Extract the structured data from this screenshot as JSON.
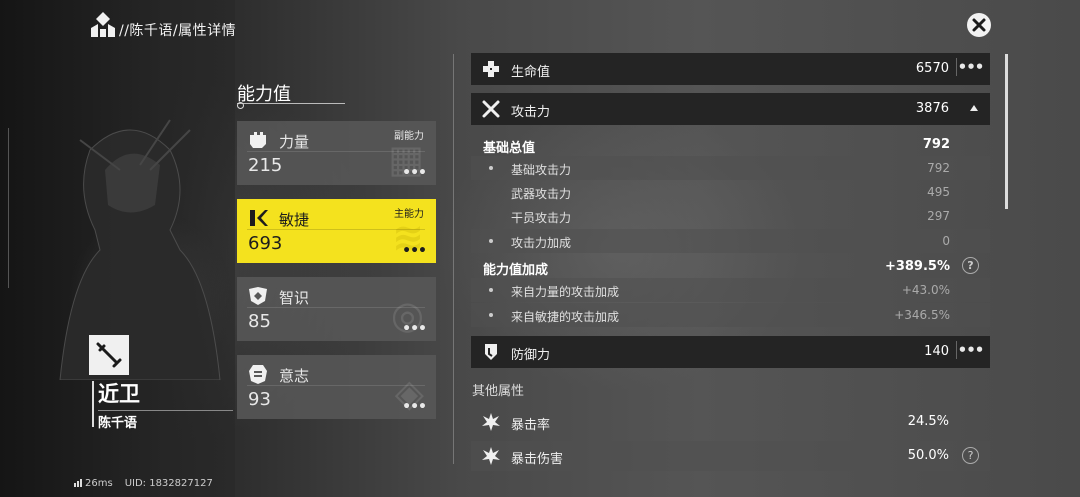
{
  "header": {
    "breadcrumb": "//陈千语/属性详情"
  },
  "character": {
    "class": "近卫",
    "name": "陈千语"
  },
  "status": {
    "ping": "26ms",
    "uid": "UID: 1832827127"
  },
  "abilities": {
    "title": "能力值",
    "cards": [
      {
        "name": "力量",
        "value": "215",
        "tag": "副能力",
        "icon": "fist-icon",
        "active": false
      },
      {
        "name": "敏捷",
        "value": "693",
        "tag": "主能力",
        "icon": "agility-icon",
        "active": true
      },
      {
        "name": "智识",
        "value": "85",
        "tag": "",
        "icon": "intellect-icon",
        "active": false
      },
      {
        "name": "意志",
        "value": "93",
        "tag": "",
        "icon": "will-icon",
        "active": false
      }
    ],
    "more": "•••"
  },
  "attributes": {
    "hp": {
      "name": "生命值",
      "value": "6570",
      "icon": "health-cross-icon"
    },
    "atk": {
      "name": "攻击力",
      "value": "3876",
      "icon": "crossed-swords-icon"
    },
    "atk_breakdown": {
      "base_total_label": "基础总值",
      "base_total_value": "792",
      "base_atk_label": "基础攻击力",
      "base_atk_value": "792",
      "weapon_atk_label": "武器攻击力",
      "weapon_atk_value": "495",
      "operator_atk_label": "干员攻击力",
      "operator_atk_value": "297",
      "atk_bonus_label": "攻击力加成",
      "atk_bonus_value": "0",
      "ability_bonus_label": "能力值加成",
      "ability_bonus_value": "+389.5%",
      "from_str_label": "来自力量的攻击加成",
      "from_str_value": "+43.0%",
      "from_agi_label": "来自敏捷的攻击加成",
      "from_agi_value": "+346.5%"
    },
    "def": {
      "name": "防御力",
      "value": "140",
      "icon": "shield-icon"
    },
    "other_title": "其他属性",
    "crit_rate": {
      "name": "暴击率",
      "value": "24.5%",
      "icon": "crit-burst-icon"
    },
    "crit_dmg": {
      "name": "暴击伤害",
      "value": "50.0%",
      "icon": "crit-damage-icon"
    },
    "help": "?",
    "more": "•••"
  },
  "colors": {
    "accent_yellow": "#f4e21e",
    "row_dark": "#242424",
    "card_gray": "#585858"
  }
}
